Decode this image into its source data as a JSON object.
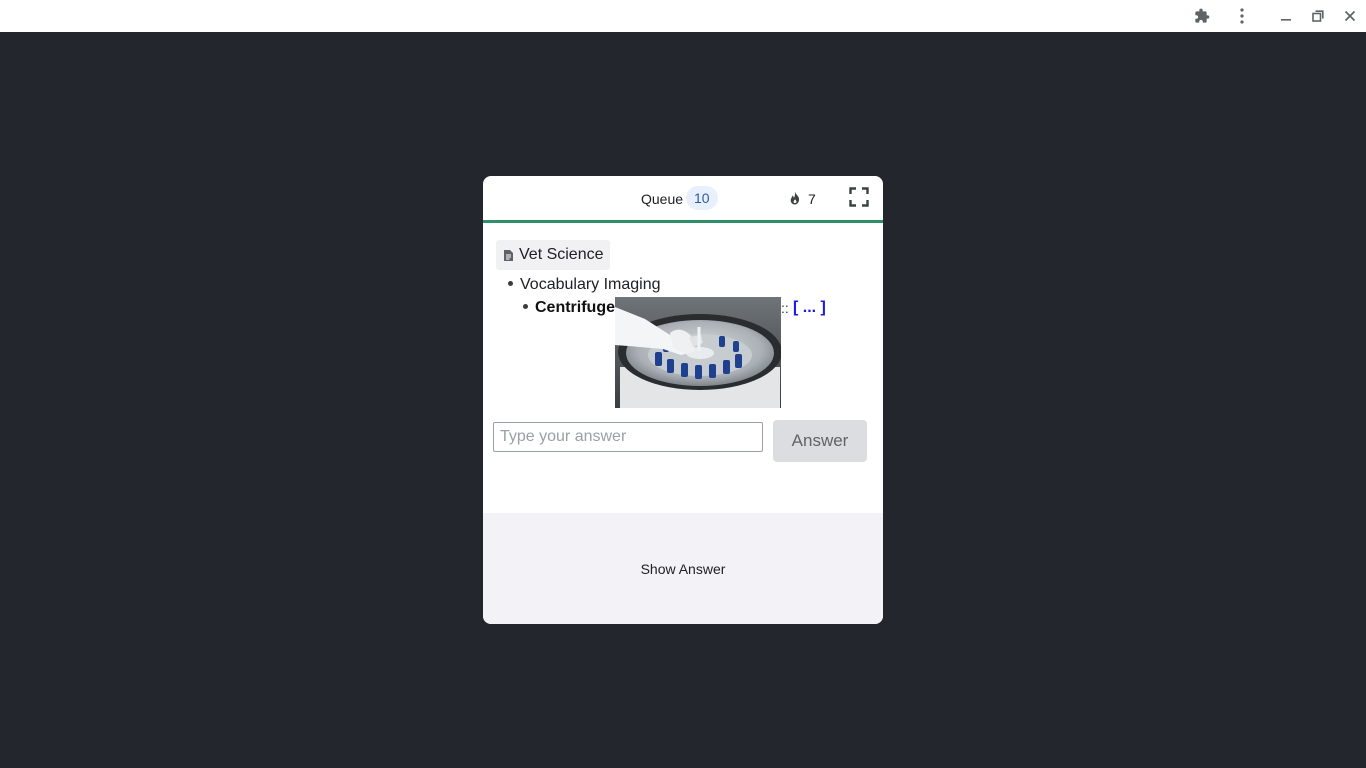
{
  "window": {
    "icons": [
      "extensions-icon",
      "more-vert-icon",
      "minimize-icon",
      "restore-icon",
      "close-icon"
    ]
  },
  "card": {
    "header": {
      "queue_label": "Queue",
      "queue_count": "10",
      "streak_count": "7",
      "accent_color": "#2f8f6b"
    },
    "deck": {
      "name": "Vet Science"
    },
    "outline": {
      "parent": "Vocabulary Imaging",
      "term": "Centrifuge",
      "separator": "::",
      "cloze": "[ ... ]"
    },
    "answer_input": {
      "placeholder": "Type your answer",
      "value": ""
    },
    "answer_button": "Answer",
    "show_answer_button": "Show Answer"
  }
}
